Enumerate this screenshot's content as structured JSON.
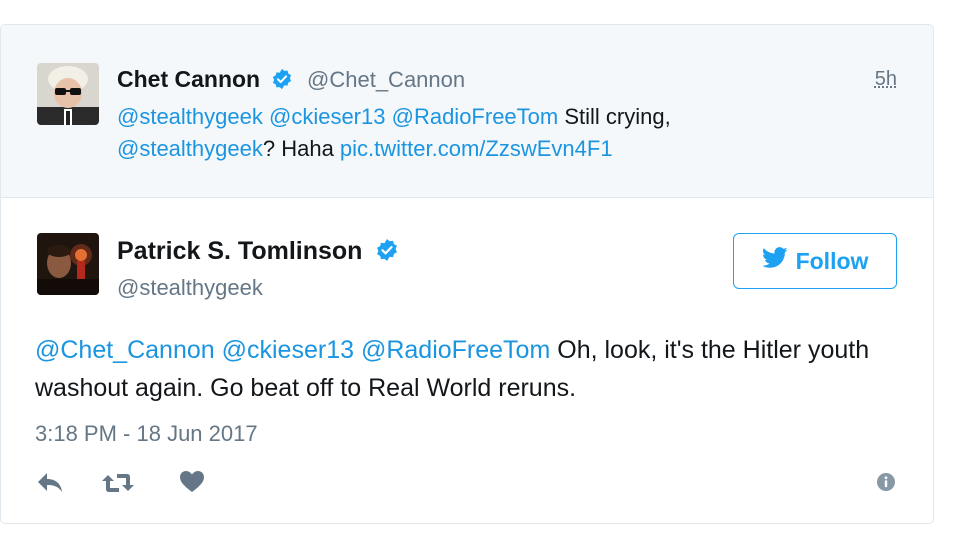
{
  "parent_tweet": {
    "name": "Chet Cannon",
    "handle": "@Chet_Cannon",
    "time": "5h",
    "text_parts": {
      "m1": "@stealthygeek",
      "m2": "@ckieser13",
      "m3": "@RadioFreeTom",
      "t1": " Still crying, ",
      "m4": "@stealthygeek",
      "t2": "? Haha ",
      "link": "pic.twitter.com/ZzswEvn4F1"
    }
  },
  "main_tweet": {
    "name": "Patrick S. Tomlinson",
    "handle": "@stealthygeek",
    "follow_label": "Follow",
    "text_parts": {
      "m1": "@Chet_Cannon",
      "m2": "@ckieser13",
      "m3": "@RadioFreeTom",
      "t1": " Oh, look, it's the Hitler youth washout again. Go beat off to Real World reruns."
    },
    "date": "3:18 PM - 18 Jun 2017"
  },
  "colors": {
    "link": "#1b95e0",
    "accent": "#1da1f2",
    "muted": "#657786",
    "text": "#14171a",
    "parent_bg": "#f5f8fa"
  },
  "icons": [
    "verified-badge-icon",
    "twitter-bird-icon",
    "reply-icon",
    "retweet-icon",
    "like-heart-icon",
    "info-icon"
  ]
}
